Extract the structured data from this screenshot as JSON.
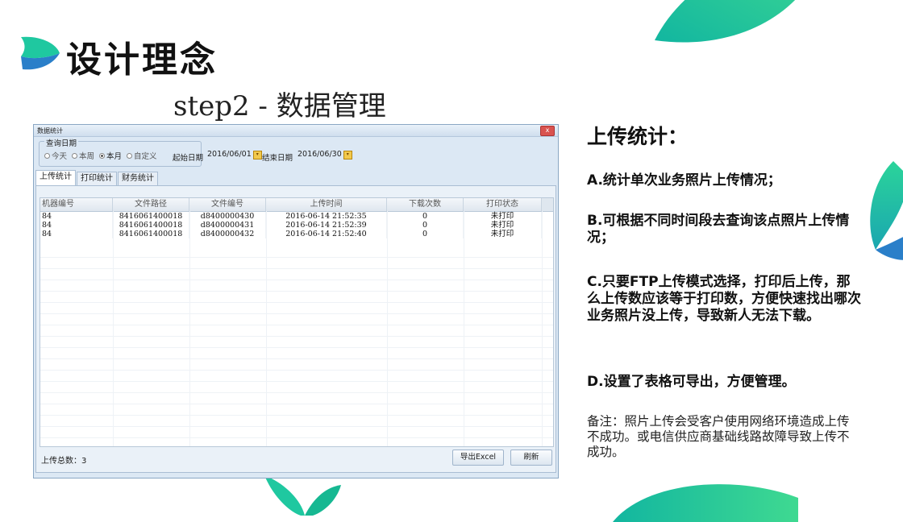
{
  "slide": {
    "title": "设计理念",
    "subtitle": "step2 - 数据管理"
  },
  "window": {
    "title": "数据统计",
    "close_label": "x",
    "query": {
      "legend": "查询日期",
      "radios": [
        {
          "label": "今天",
          "checked": false
        },
        {
          "label": "本周",
          "checked": false
        },
        {
          "label": "本月",
          "checked": true
        },
        {
          "label": "自定义",
          "checked": false
        }
      ],
      "start_label": "起始日期",
      "start_value": "2016/06/01",
      "end_label": "结束日期",
      "end_value": "2016/06/30"
    },
    "tabs": [
      {
        "label": "上传统计",
        "active": true
      },
      {
        "label": "打印统计",
        "active": false
      },
      {
        "label": "财务统计",
        "active": false
      }
    ],
    "table": {
      "columns": [
        "机器编号",
        "文件路径",
        "文件编号",
        "上传时间",
        "下载次数",
        "打印状态"
      ],
      "rows": [
        [
          "84",
          "8416061400018",
          "d8400000430",
          "2016-06-14 21:52:35",
          "0",
          "未打印"
        ],
        [
          "84",
          "8416061400018",
          "d8400000431",
          "2016-06-14 21:52:39",
          "0",
          "未打印"
        ],
        [
          "84",
          "8416061400018",
          "d8400000432",
          "2016-06-14 21:52:40",
          "0",
          "未打印"
        ]
      ]
    },
    "total": "上传总数：3",
    "export_button": "导出Excel",
    "refresh_button": "刷新"
  },
  "right": {
    "title": "上传统计：",
    "items": [
      "A.统计单次业务照片上传情况；",
      "B.可根据不同时间段去查询该点照片上传情况；",
      "C.只要FTP上传模式选择，打印后上传，那么上传数应该等于打印数，方便快速找出哪次业务照片没上传，导致新人无法下载。",
      "D.设置了表格可导出，方便管理。"
    ],
    "note": "备注：照片上传会受客户使用网络环境造成上传不成功。或电信供应商基础线路故障导致上传不成功。"
  },
  "colors": {
    "teal": "#1fc8a0",
    "blue": "#2a7fc9"
  }
}
